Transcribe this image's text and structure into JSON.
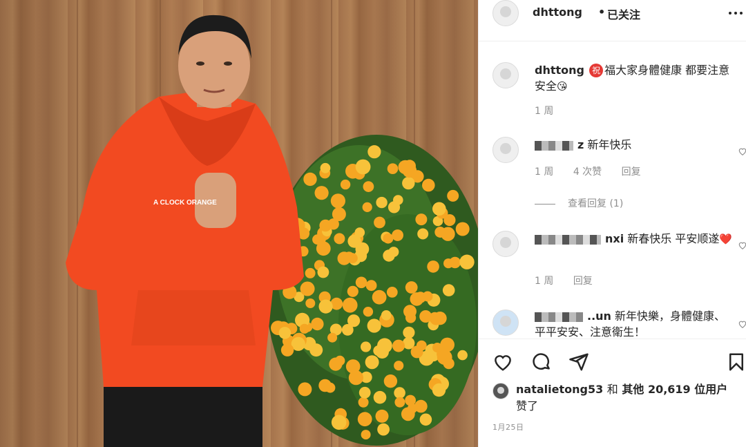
{
  "post": {
    "username": "dhttong",
    "separator": "•",
    "follow_status": "已关注",
    "caption_user": "dhttong",
    "caption_badge": "祝",
    "caption_text": "福大家身體健康 都要注意安全",
    "caption_emoji": "😘",
    "caption_time": "1 周"
  },
  "comments": [
    {
      "user_suffix": "z",
      "text": "新年快乐",
      "time": "1 周",
      "likes": "4 次赞",
      "reply": "回复"
    },
    {
      "user_suffix": "nxi",
      "text": "新春快乐 平安顺遂",
      "emoji": "❤️",
      "time": "1 周",
      "reply": "回复"
    },
    {
      "user_suffix": "..un",
      "text": "新年快樂，身體健康、平平安安、注意衛生！"
    }
  ],
  "view_replies": "查看回复 (1)",
  "likes": {
    "first_user": "natalietong53",
    "connector": "和",
    "others": "其他 20,619 位用户",
    "suffix": "赞了"
  },
  "date": "1月25日",
  "photo": {
    "hoodie_text": "A CLOCK ORANGE"
  },
  "colors": {
    "hoodie": "#f24a21",
    "badge": "#e53935",
    "muted": "#8e8e8e"
  }
}
